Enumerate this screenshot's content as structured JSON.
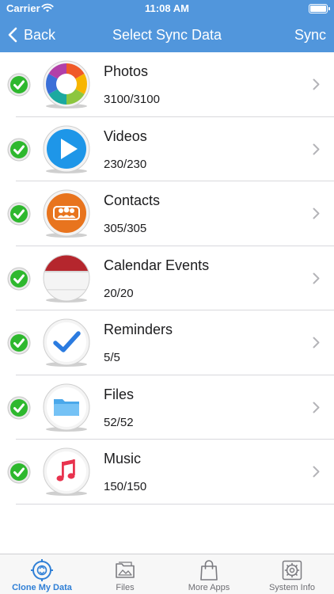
{
  "status_bar": {
    "carrier": "Carrier",
    "time": "11:08 AM"
  },
  "nav": {
    "back_label": "Back",
    "title": "Select Sync Data",
    "sync_label": "Sync"
  },
  "items": [
    {
      "name": "Photos",
      "count": "3100/3100",
      "icon": "photos-icon",
      "checked": true
    },
    {
      "name": "Videos",
      "count": "230/230",
      "icon": "videos-icon",
      "checked": true
    },
    {
      "name": "Contacts",
      "count": "305/305",
      "icon": "contacts-icon",
      "checked": true
    },
    {
      "name": "Calendar Events",
      "count": "20/20",
      "icon": "calendar-icon",
      "checked": true
    },
    {
      "name": "Reminders",
      "count": "5/5",
      "icon": "reminders-icon",
      "checked": true
    },
    {
      "name": "Files",
      "count": "52/52",
      "icon": "files-icon",
      "checked": true
    },
    {
      "name": "Music",
      "count": "150/150",
      "icon": "music-icon",
      "checked": true
    }
  ],
  "tabs": [
    {
      "label": "Clone My Data",
      "icon": "clone-data-icon",
      "active": true
    },
    {
      "label": "Files",
      "icon": "files-tab-icon",
      "active": false
    },
    {
      "label": "More Apps",
      "icon": "shopping-bag-icon",
      "active": false
    },
    {
      "label": "System Info",
      "icon": "gear-chip-icon",
      "active": false
    }
  ],
  "colors": {
    "header": "#5196dc",
    "check_green": "#2eb82e",
    "tab_active": "#2f7fd6"
  }
}
